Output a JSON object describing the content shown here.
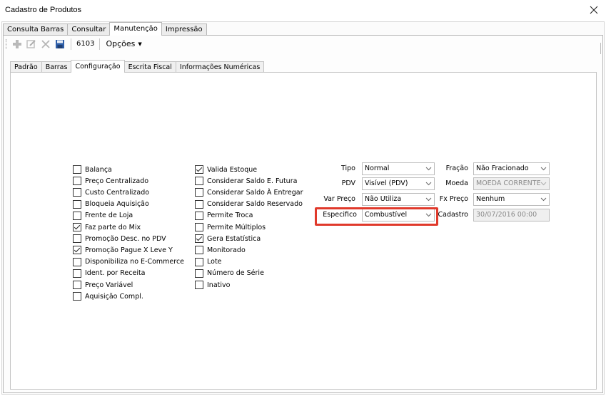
{
  "window": {
    "title": "Cadastro de Produtos"
  },
  "main_tabs": [
    {
      "label": "Consulta Barras",
      "active": false
    },
    {
      "label": "Consultar",
      "active": false
    },
    {
      "label": "Manutenção",
      "active": true
    },
    {
      "label": "Impressão",
      "active": false
    }
  ],
  "toolbar": {
    "icons": [
      "add-icon",
      "edit-icon",
      "delete-icon",
      "save-icon"
    ],
    "code": "6103",
    "options_label": "Opções"
  },
  "sub_tabs": [
    {
      "label": "Padrão",
      "active": false
    },
    {
      "label": "Barras",
      "active": false
    },
    {
      "label": "Configuração",
      "active": true
    },
    {
      "label": "Escrita Fiscal",
      "active": false
    },
    {
      "label": "Informações Numéricas",
      "active": false
    }
  ],
  "checkboxes_col1": [
    {
      "label": "Balança",
      "checked": false
    },
    {
      "label": "Preço Centralizado",
      "checked": false
    },
    {
      "label": "Custo Centralizado",
      "checked": false
    },
    {
      "label": "Bloqueia Aquisição",
      "checked": false
    },
    {
      "label": "Frente de Loja",
      "checked": false
    },
    {
      "label": "Faz parte do Mix",
      "checked": true
    },
    {
      "label": "Promoção Desc. no PDV",
      "checked": false
    },
    {
      "label": "Promoção Pague X Leve Y",
      "checked": true
    },
    {
      "label": "Disponibiliza no E-Commerce",
      "checked": false
    },
    {
      "label": "Ident. por Receita",
      "checked": false
    },
    {
      "label": "Preço Variável",
      "checked": false
    },
    {
      "label": "Aquisição Compl.",
      "checked": false
    }
  ],
  "checkboxes_col2": [
    {
      "label": "Valida Estoque",
      "checked": true
    },
    {
      "label": "Considerar Saldo E. Futura",
      "checked": false
    },
    {
      "label": "Considerar Saldo À Entregar",
      "checked": false
    },
    {
      "label": "Considerar Saldo Reservado",
      "checked": false
    },
    {
      "label": "Permite Troca",
      "checked": false
    },
    {
      "label": "Permite Múltiplos",
      "checked": false
    },
    {
      "label": "Gera Estatística",
      "checked": true
    },
    {
      "label": "Monitorado",
      "checked": false
    },
    {
      "label": "Lote",
      "checked": false
    },
    {
      "label": "Número de Série",
      "checked": false
    },
    {
      "label": "Inativo",
      "checked": false
    }
  ],
  "fields": {
    "tipo": {
      "label": "Tipo",
      "value": "Normal"
    },
    "pdv": {
      "label": "PDV",
      "value": "Visível (PDV)"
    },
    "var_preco": {
      "label": "Var Preço",
      "value": "Não Utiliza"
    },
    "especifico": {
      "label": "Especifico",
      "value": "Combustível"
    },
    "fracao": {
      "label": "Fração",
      "value": "Não Fracionado"
    },
    "moeda": {
      "label": "Moeda",
      "value": "MOEDA CORRENTE"
    },
    "fx_preco": {
      "label": "Fx Preço",
      "value": "Nenhum"
    },
    "cadastro": {
      "label": "Cadastro",
      "value": "30/07/2016 00:00"
    }
  },
  "colors": {
    "highlight": "#e0392b",
    "checkbox_border": "#333333",
    "tab_border": "#b8b8b8"
  }
}
